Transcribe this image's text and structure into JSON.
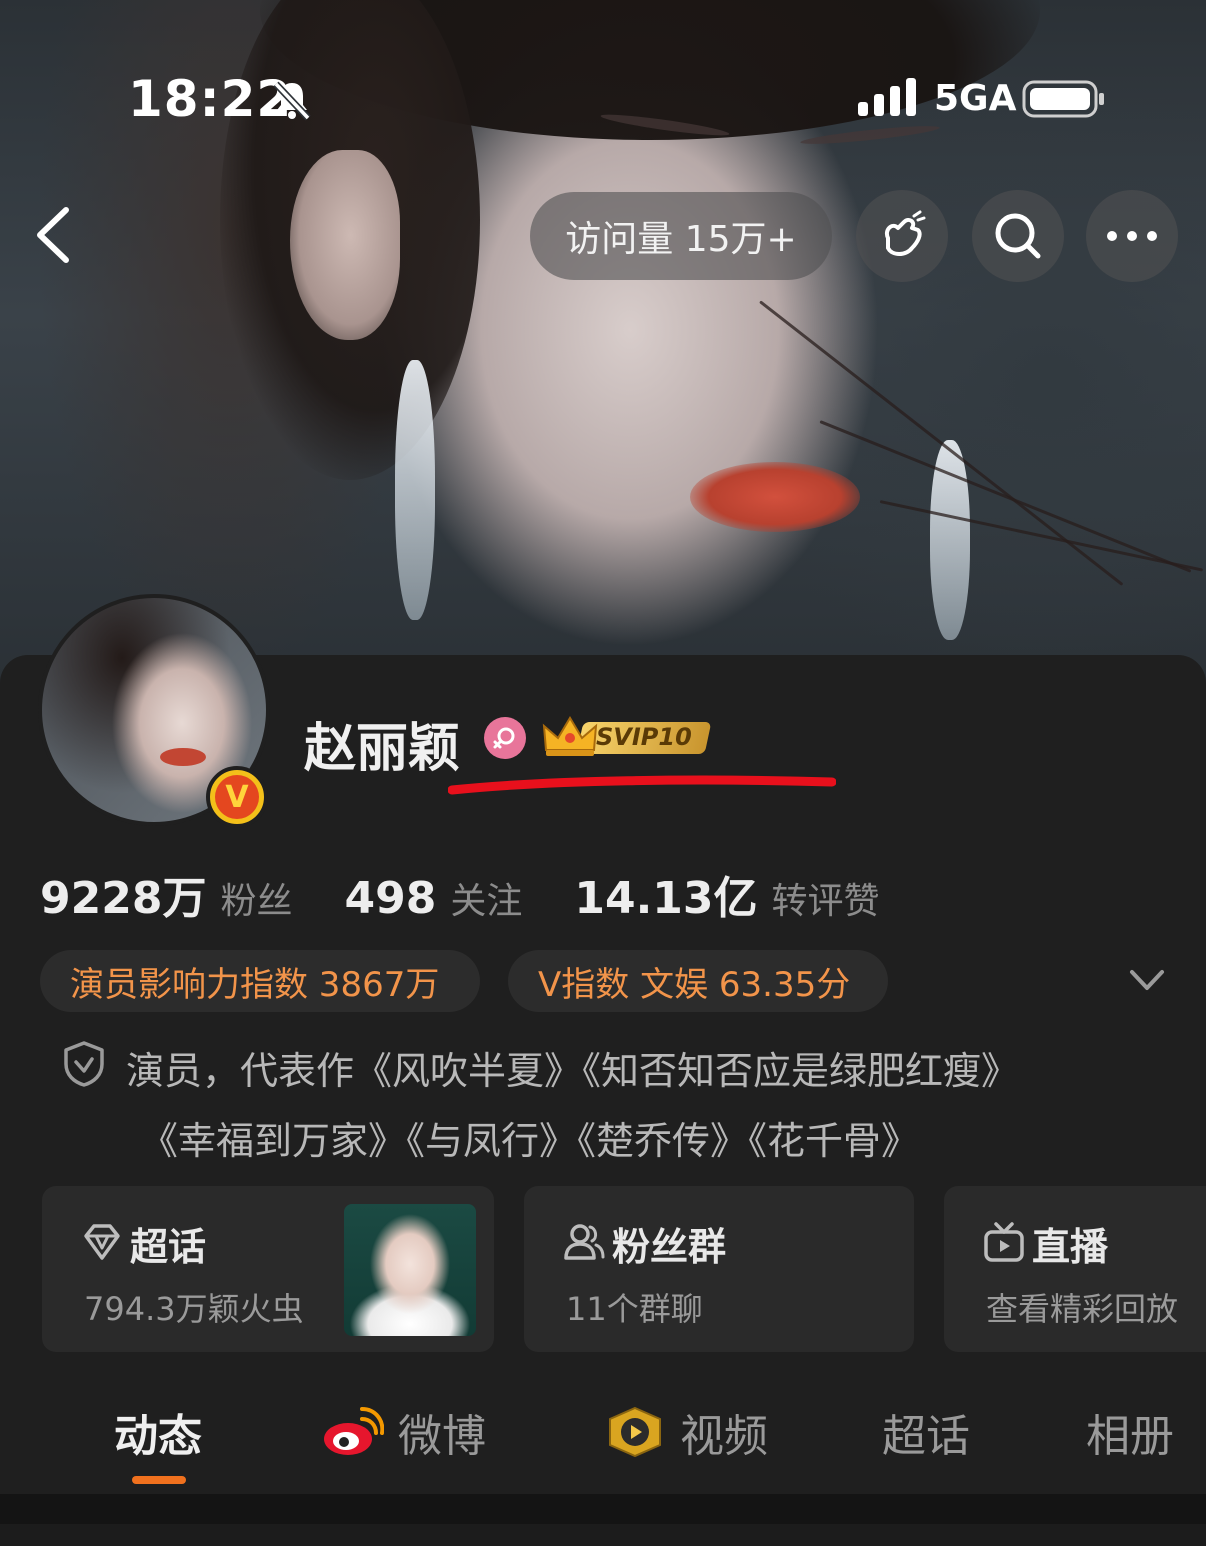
{
  "status_bar": {
    "time": "18:22",
    "network": "5GA",
    "icons": [
      "bell-muted-icon",
      "signal-icon",
      "battery-icon"
    ]
  },
  "nav": {
    "back_icon": "chevron-left-icon",
    "visits_label": "访问量 15万+",
    "icons": [
      "greeting-hand-icon",
      "search-icon",
      "more-icon"
    ]
  },
  "profile": {
    "name": "赵丽颖",
    "svip_label": "SVIP10",
    "verified_mark": "V",
    "colors": {
      "accent": "#f0711e",
      "tag_text": "#f2944a",
      "verified": "#f3c01a",
      "gender": "#e8759a"
    }
  },
  "stats": [
    {
      "value": "9228万",
      "label": "粉丝"
    },
    {
      "value": "498",
      "label": "关注"
    },
    {
      "value": "14.13亿",
      "label": "转评赞"
    }
  ],
  "tags": {
    "influence": "演员影响力指数 3867万",
    "v_index": "V指数  文娱 63.35分"
  },
  "bio": {
    "line1": "演员，代表作《风吹半夏》《知否知否应是绿肥红瘦》",
    "line2": "《幸福到万家》《与凤行》《楚乔传》《花千骨》"
  },
  "cards": [
    {
      "title": "超话",
      "subtitle": "794.3万颖火虫",
      "icon": "diamond-icon"
    },
    {
      "title": "粉丝群",
      "subtitle": "11个群聊",
      "icon": "group-icon"
    },
    {
      "title": "直播",
      "subtitle": "查看精彩回放",
      "icon": "tv-icon"
    }
  ],
  "tabs": [
    {
      "label": "动态",
      "active": true
    },
    {
      "label": "微博",
      "icon": "weibo-logo-icon"
    },
    {
      "label": "视频",
      "icon": "video-play-icon"
    },
    {
      "label": "超话"
    },
    {
      "label": "相册"
    }
  ]
}
